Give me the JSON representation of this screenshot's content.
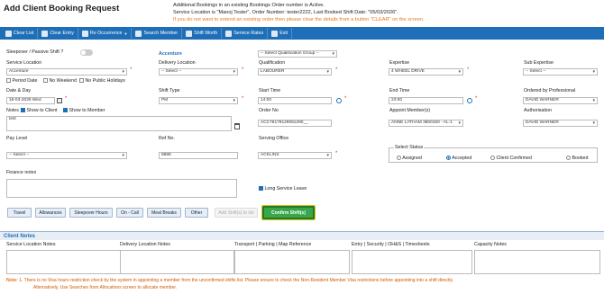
{
  "page": {
    "title": "Add Client Booking Request",
    "notice_line1": "Additional Bookings in an existing Bookings Order number is Active.",
    "notice_line2": "Service Location is \"Manoj Tester\", Order Number: tester2222, Last Booked Shift Date: \"05/03/2026\".",
    "notice_line3": "If you do not want to extend an existing order then please clear the details from a button \"CLEAR\" on the screen."
  },
  "toolbar": {
    "clear_list": "Clear List",
    "clear_entry": "Clear Entry",
    "re_occurrence": "Re Occurrence",
    "search_member": "Search Member",
    "shift_worth": "Shift Worth",
    "service_rates": "Service Rates",
    "exit": "Exit"
  },
  "form": {
    "sleepover_label": "Sleepover / Passive Shift ?",
    "client_name": "Accenture",
    "qualification_group_placeholder": "-- Select Qualification Group --",
    "service_location_label": "Service Location",
    "service_location_value": "Accenture",
    "delivery_location_label": "Delivery Location",
    "delivery_location_value": "-- Select --",
    "qualification_label": "Qualification",
    "qualification_value": "LABOURER",
    "expertise_label": "Expertise",
    "expertise_value": "4 WHEEL DRIVE",
    "sub_expertise_label": "Sub Expertise",
    "sub_expertise_value": "-- Select --",
    "period_date": "Period Date",
    "no_weekend": "No Weekend",
    "no_public_holidays": "No Public Holidays",
    "date_day_label": "Date & Day",
    "date_day_value": "18-03-2026 Wed",
    "shift_type_label": "Shift Type",
    "shift_type_value": "PM",
    "start_time_label": "Start Time",
    "start_time_value": "14:00",
    "end_time_label": "End Time",
    "end_time_value": "23:00",
    "ordered_by_label": "Ordered by Professional",
    "ordered_by_value": "DAVID WARNER",
    "notes_label": "Notes",
    "show_to_client": "Show to Client",
    "show_to_member": "Show to Member",
    "notes_value": "test",
    "order_no_label": "Order No",
    "order_no_value": "ACC78179129081290__",
    "appoint_member_label": "Appoint Member(s)",
    "appoint_member_value": "ANNE LATHAM 3800150 - AL-1",
    "authorisation_label": "Authorisation",
    "authorisation_value": "DAVID WARNER",
    "pay_level_label": "Pay Level",
    "pay_level_value": "-- Select --",
    "ref_no_label": "Ref No.",
    "ref_no_value": "8888",
    "serving_office_label": "Serving Office",
    "serving_office_value": "ACKLINS",
    "select_status_label": "Select Status",
    "status_assigned": "Assigned",
    "status_accepted": "Accepted",
    "status_client_confirmed": "Client Confirmed",
    "status_booked": "Booked",
    "finance_notes_label": "Finance notes",
    "long_service_leave": "Long Service Leave"
  },
  "buttons": {
    "travel": "Travel",
    "allowances": "Allowances",
    "sleepover_hours": "Sleepover Hours",
    "on_call": "On - Call",
    "meal_breaks": "Meal Breaks",
    "other": "Other",
    "add_shifts_to_list": "Add Shift(s) to list",
    "confirm_shifts": "Confirm Shift(s)"
  },
  "client_notes": {
    "title": "Client Notes",
    "columns": [
      "Service Location Notes",
      "Delivery Location Notes",
      "Transport | Parking | Map Reference",
      "Entry | Security | OH&S | Timesheets",
      "Capacity Notes"
    ]
  },
  "footer": {
    "note_label": "Note:",
    "note_1": "1. There is no Visa hours restriction check by the system in appointing a member from the unconfirmed shifts list. Please ensure to check the Non-Resident Member Visa restrictions before appointing into a shift directly.",
    "note_2": "Alternatively, Use Searches from Allocations screen to allocate member."
  },
  "colors": {
    "toolbar_bg": "#1f6fb8",
    "confirm_bg": "#3aa64c",
    "warning_text": "#e07a1f"
  }
}
